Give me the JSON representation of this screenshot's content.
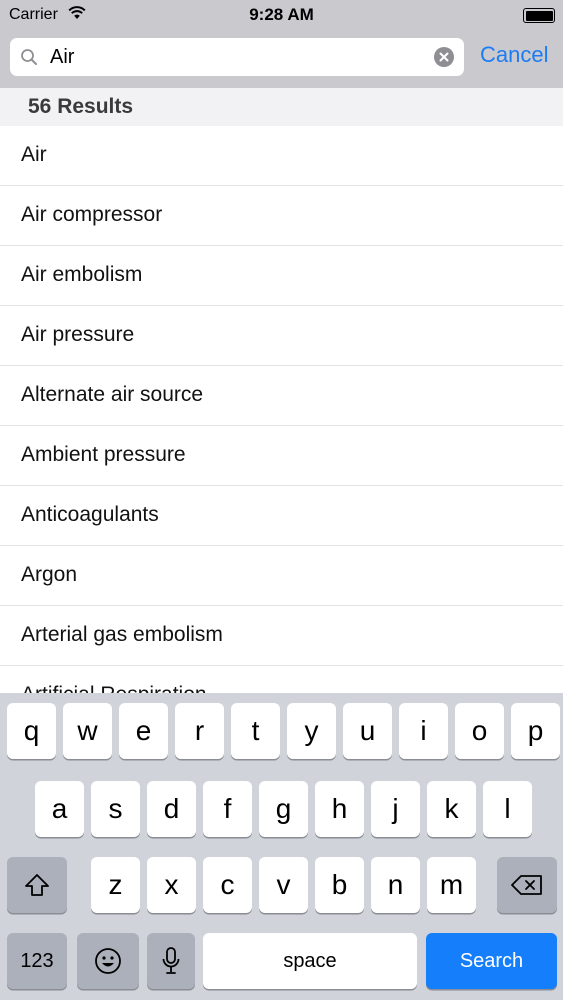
{
  "status_bar": {
    "carrier": "Carrier",
    "time": "9:28 AM"
  },
  "search": {
    "value": "Air",
    "cancel_label": "Cancel"
  },
  "results": {
    "count_label": "56 Results",
    "items": [
      "Air",
      "Air compressor",
      "Air embolism",
      "Air pressure",
      "Alternate air source",
      "Ambient pressure",
      "Anticoagulants",
      "Argon",
      "Arterial gas embolism",
      "Artificial Respiration"
    ]
  },
  "keyboard": {
    "row1": [
      "q",
      "w",
      "e",
      "r",
      "t",
      "y",
      "u",
      "i",
      "o",
      "p"
    ],
    "row2": [
      "a",
      "s",
      "d",
      "f",
      "g",
      "h",
      "j",
      "k",
      "l"
    ],
    "row3": [
      "z",
      "x",
      "c",
      "v",
      "b",
      "n",
      "m"
    ],
    "numbers_label": "123",
    "space_label": "space",
    "search_label": "Search",
    "icons": {
      "shift": "shift-icon",
      "delete": "delete-icon",
      "emoji": "emoji-icon",
      "mic": "microphone-icon"
    }
  },
  "colors": {
    "accent": "#1c7cf4",
    "search_key": "#157efb",
    "keyboard_bg": "#d0d3d9",
    "bar_bg": "#c9c9ce"
  }
}
